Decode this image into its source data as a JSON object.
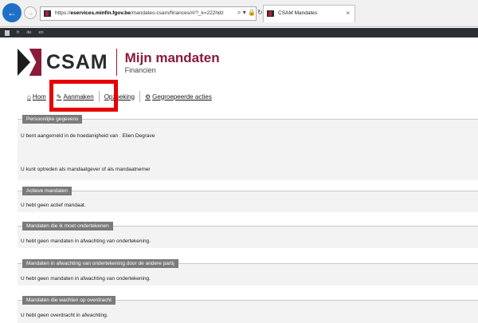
{
  "browser": {
    "url_prefix": "https://",
    "url_domain": "eservices.minfin.fgov.be",
    "url_path": "/mandates-csam/finances/#/?_k=222hdz",
    "address_tools": "⌕ ▾ 🔒 ↻",
    "tab_title": "CSAM Mandates",
    "tab_close": "×",
    "back_glyph": "←",
    "forward_glyph": "→",
    "icons": {
      "back": "back-arrow-icon",
      "forward": "forward-arrow-icon",
      "favicon": "csam-favicon-icon"
    }
  },
  "langbar": {
    "languages": [
      "fr",
      "de",
      "en"
    ]
  },
  "header": {
    "logo_text": "CSAM",
    "title": "Mijn mandaten",
    "subtitle": "Financien",
    "brand_color": "#8a1b3a"
  },
  "menu": {
    "items": [
      {
        "label": "Hom",
        "icon": "home-icon",
        "glyph": "⌂"
      },
      {
        "label": "Aanmaken",
        "icon": "pencil-icon",
        "glyph": "✎"
      },
      {
        "label": "Opzoeking",
        "icon": "",
        "glyph": ""
      },
      {
        "label": "Gegroepeerde acties",
        "icon": "gear-icon",
        "glyph": "⚙"
      }
    ],
    "highlight_color": "#e60000"
  },
  "sections": [
    {
      "legend": "Persoonlijke gegevens",
      "lines": [
        "U bent aangemeld in de hoedanigheid van : Elien Degrave",
        "U kunt optreden als mandaatgever of als mandaatnemer"
      ]
    },
    {
      "legend": "Actieve mandaten",
      "lines": [
        "U hebt geen actief mandaat."
      ]
    },
    {
      "legend": "Mandaten die ik moet ondertekenen",
      "lines": [
        "U hebt geen mandaten in afwachting van ondertekening."
      ]
    },
    {
      "legend": "Mandaten in afwachting van ondertekening door de andere partij",
      "lines": [
        "U hebt geen mandaten in afwachting van ondertekening."
      ]
    },
    {
      "legend": "Mandaten die wachten op overdracht",
      "lines": [
        "U hebt geen overdracht in afwachting."
      ]
    }
  ]
}
